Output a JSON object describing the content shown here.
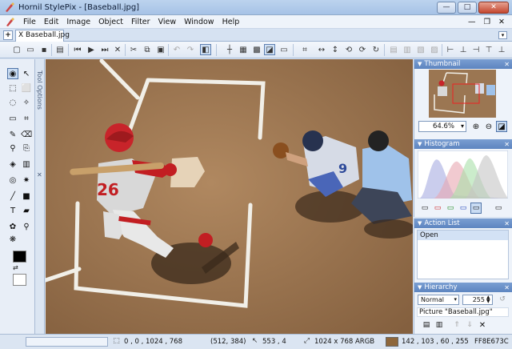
{
  "window": {
    "title": "Hornil StylePix - [Baseball.jpg]",
    "minimize": "—",
    "maximize": "□",
    "close": "✕"
  },
  "menu": {
    "items": [
      "File",
      "Edit",
      "Image",
      "Object",
      "Filter",
      "View",
      "Window",
      "Help"
    ],
    "minimize": "—",
    "restore": "❐",
    "close": "✕"
  },
  "document_tabs": {
    "add": "+",
    "tab_label": "X Baseball.jpg",
    "menu": "▾"
  },
  "tool_options": {
    "label": "Tool Options",
    "close": "✕"
  },
  "panels": {
    "thumbnail": {
      "title": "Thumbnail",
      "zoom": "64.6%",
      "zoom_dropdown": "▾"
    },
    "histogram": {
      "title": "Histogram",
      "channels": [
        "RGB",
        "Red",
        "Green",
        "Blue",
        "Alpha"
      ]
    },
    "action_list": {
      "title": "Action List",
      "items": [
        "Open"
      ]
    },
    "hierarchy": {
      "title": "Hierarchy",
      "blend_mode": "Normal",
      "opacity": "255",
      "items": [
        "Picture \"Baseball.jpg\""
      ]
    }
  },
  "status": {
    "selection": "0      , 0       , 1024  , 768",
    "coords": "(512, 384)",
    "pointer": "553    , 4",
    "image_info": "1024 x 768 ARGB",
    "color_values": "142  , 103  , 60    , 255",
    "color_hex": "FF8E673C",
    "color_swatch": "#8e673c"
  },
  "colors": {
    "foreground": "#000000",
    "background": "#ffffff",
    "accent": "#5d85c0"
  }
}
